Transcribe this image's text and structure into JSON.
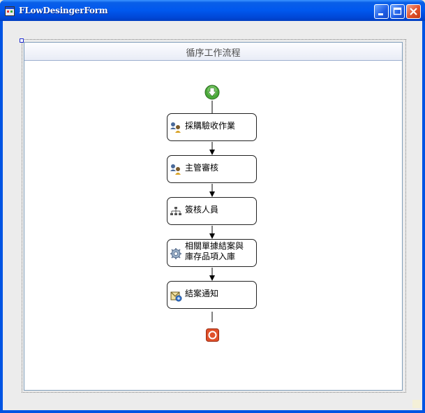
{
  "window": {
    "title": "FLowDesingerForm",
    "controls": [
      "minimize-icon",
      "maximize-icon",
      "close-icon"
    ]
  },
  "workflow": {
    "title": "循序工作流程",
    "start_icon": "start-arrow-icon",
    "end_icon": "stop-icon",
    "steps": [
      {
        "label": "採購驗收作業",
        "icon": "users-icon"
      },
      {
        "label": "主管審核",
        "icon": "users-icon"
      },
      {
        "label": "簽核人員",
        "icon": "org-chart-icon"
      },
      {
        "label_line1": "相關單據結案與",
        "label_line2": "庫存品項入庫",
        "icon": "gear-icon"
      },
      {
        "label": "結案通知",
        "icon": "notify-icon"
      }
    ]
  },
  "colors": {
    "titlebar": "#0058ee",
    "panel_border": "#7f9db9",
    "start": "#3a9a2a",
    "end": "#d9421c"
  }
}
